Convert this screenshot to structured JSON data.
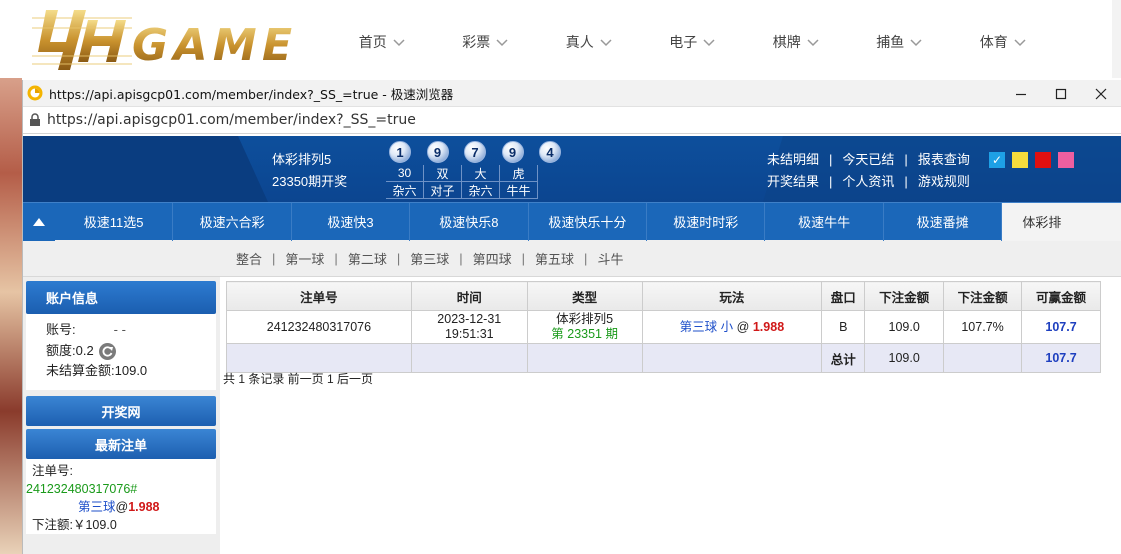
{
  "site": {
    "logo_text": "4H GAME",
    "nav": [
      {
        "label": "首页"
      },
      {
        "label": "彩票"
      },
      {
        "label": "真人"
      },
      {
        "label": "电子"
      },
      {
        "label": "棋牌"
      },
      {
        "label": "捕鱼"
      },
      {
        "label": "体育"
      }
    ]
  },
  "browser": {
    "title": "https://api.apisgcp01.com/member/index?_SS_=true - 极速浏览器",
    "url": "https://api.apisgcp01.com/member/index?_SS_=true",
    "controls": [
      "minimize",
      "maximize",
      "close"
    ]
  },
  "lottery": {
    "name": "体彩排列5",
    "period_text": "23350期开奖",
    "balls": [
      "1",
      "9",
      "7",
      "9",
      "4"
    ],
    "stats_row1": [
      "30",
      "双",
      "大",
      "虎"
    ],
    "stats_row2": [
      "杂六",
      "对子",
      "杂六",
      "牛牛"
    ],
    "links_row1": [
      "未结明细",
      "今天已结",
      "报表查询"
    ],
    "links_row2": [
      "开奖结果",
      "个人资讯",
      "游戏规则"
    ],
    "theme_colors": [
      "#1ea0e6",
      "#f6dc3c",
      "#e01010",
      "#ee5fa0"
    ],
    "checked_theme": "✓"
  },
  "game_tabs": [
    "极速11选5",
    "极速六合彩",
    "极速快3",
    "极速快乐8",
    "极速快乐十分",
    "极速时时彩",
    "极速牛牛",
    "极速番摊",
    "体彩排"
  ],
  "sub_tabs": [
    "整合",
    "第一球",
    "第二球",
    "第三球",
    "第四球",
    "第五球",
    "斗牛"
  ],
  "account": {
    "header": "账户信息",
    "account_label": "账号:",
    "account_value": "- -",
    "quota_label": "额度:",
    "quota_value": "0.2",
    "unsettled_label": "未结算金额:",
    "unsettled_value": "109.0"
  },
  "buttons": {
    "draw_site": "开奖网",
    "latest_bets": "最新注单"
  },
  "latest": {
    "order_label": "注单号:",
    "order_no": "241232480317076#",
    "play": "第三球",
    "odds_at": "@",
    "odds": "1.988",
    "amount_label": "下注额:",
    "amount": "￥109.0"
  },
  "table": {
    "headers": [
      "注单号",
      "时间",
      "类型",
      "玩法",
      "盘口",
      "下注金额",
      "下注金额",
      "可赢金额"
    ],
    "row": {
      "order_no": "241232480317076",
      "date": "2023-12-31",
      "time": "19:51:31",
      "type": "体彩排列5",
      "period": "第 23351 期",
      "play_name": "第三球",
      "play_option": "小",
      "odds_at": "@",
      "odds": "1.988",
      "market": "B",
      "amount": "109.0",
      "rebate": "107.7%",
      "win": "107.7"
    },
    "total_label": "总计",
    "total_amount": "109.0",
    "total_win": "107.7"
  },
  "pager": "共 1 条记录 前一页 1 后一页"
}
